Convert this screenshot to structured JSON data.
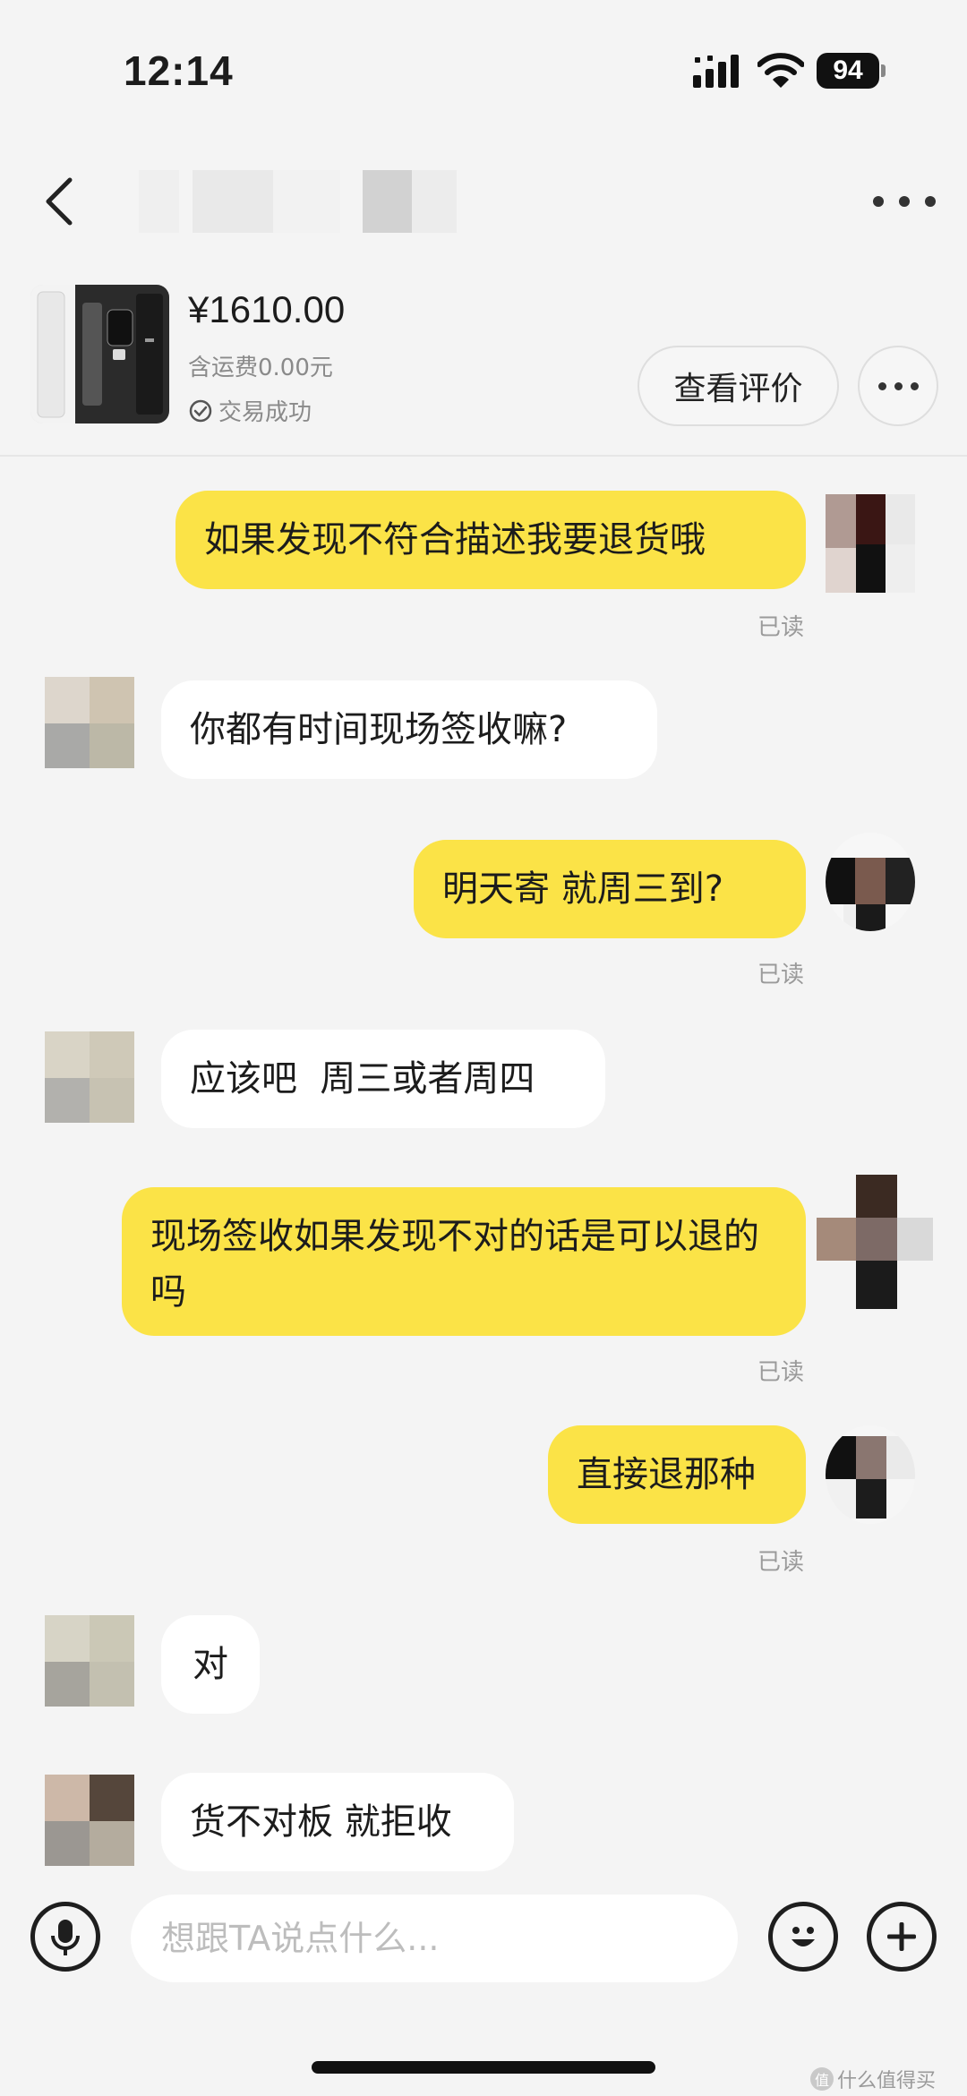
{
  "status_bar": {
    "time": "12:14",
    "battery": "94"
  },
  "header": {
    "contact_name": ""
  },
  "product": {
    "price": "¥1610.00",
    "shipping": "含运费0.00元",
    "trade_status": "交易成功",
    "review_button": "查看评价"
  },
  "messages": [
    {
      "side": "out",
      "text": "如果发现不符合描述我要退货哦",
      "read": "已读"
    },
    {
      "side": "in",
      "text": "你都有时间现场签收嘛?"
    },
    {
      "side": "out",
      "text": "明天寄 就周三到?",
      "read": "已读"
    },
    {
      "side": "in",
      "text": "应该吧  周三或者周四"
    },
    {
      "side": "out",
      "text": "现场签收如果发现不对的话是可以退的吗",
      "read": "已读"
    },
    {
      "side": "out",
      "text": "直接退那种",
      "read": "已读"
    },
    {
      "side": "in",
      "text": "对"
    },
    {
      "side": "in",
      "text": "货不对板 就拒收"
    }
  ],
  "input": {
    "placeholder": "想跟TA说点什么..."
  },
  "watermark": {
    "badge": "值",
    "text": "什么值得买"
  }
}
